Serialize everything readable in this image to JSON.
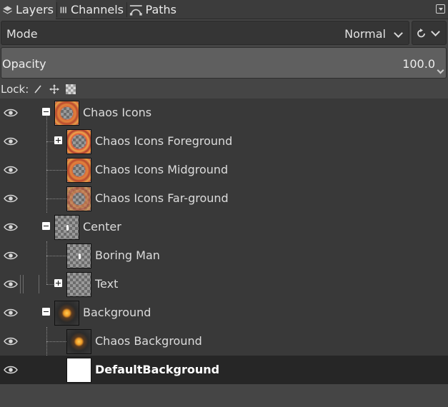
{
  "tabs": [
    {
      "label": "Layers",
      "icon": "layers-icon",
      "active": true
    },
    {
      "label": "Channels",
      "icon": "channels-icon",
      "active": false
    },
    {
      "label": "Paths",
      "icon": "paths-icon",
      "active": false
    }
  ],
  "mode": {
    "label": "Mode",
    "value": "Normal"
  },
  "opacity": {
    "label": "Opacity",
    "value": "100.0"
  },
  "lock": {
    "label": "Lock:",
    "icons": [
      "paintbrush-icon",
      "move-icon",
      "checkerboard-icon"
    ]
  },
  "layers": [
    {
      "name": "Chaos Icons",
      "level": 0,
      "expander": "minus",
      "thumb": "chaos",
      "selected": false,
      "visible": true
    },
    {
      "name": "Chaos Icons Foreground",
      "level": 1,
      "expander": "plus",
      "thumb": "chaos-fg",
      "selected": false,
      "visible": true
    },
    {
      "name": "Chaos Icons Midground",
      "level": 1,
      "expander": "none",
      "thumb": "chaos",
      "selected": false,
      "visible": true
    },
    {
      "name": "Chaos Icons Far-ground",
      "level": 1,
      "expander": "none",
      "thumb": "chaos-faint",
      "selected": false,
      "visible": true
    },
    {
      "name": "Center",
      "level": 0,
      "expander": "minus",
      "thumb": "center",
      "selected": false,
      "visible": true
    },
    {
      "name": "Boring Man",
      "level": 1,
      "expander": "none",
      "thumb": "center",
      "selected": false,
      "visible": true
    },
    {
      "name": "Text",
      "level": 1,
      "expander": "plus",
      "thumb": "checker",
      "selected": false,
      "visible": true
    },
    {
      "name": "Background",
      "level": 0,
      "expander": "minus",
      "thumb": "dark-orb",
      "selected": false,
      "visible": true
    },
    {
      "name": "Chaos Background",
      "level": 1,
      "expander": "none",
      "thumb": "dark-orb",
      "selected": false,
      "visible": true
    },
    {
      "name": "DefaultBackground",
      "level": 0,
      "expander": "none",
      "thumb": "white",
      "selected": true,
      "visible": true
    }
  ],
  "colors": {
    "panel": "#454545",
    "list": "#393939",
    "selected_row": "#262626",
    "text": "#dcdcdc"
  }
}
